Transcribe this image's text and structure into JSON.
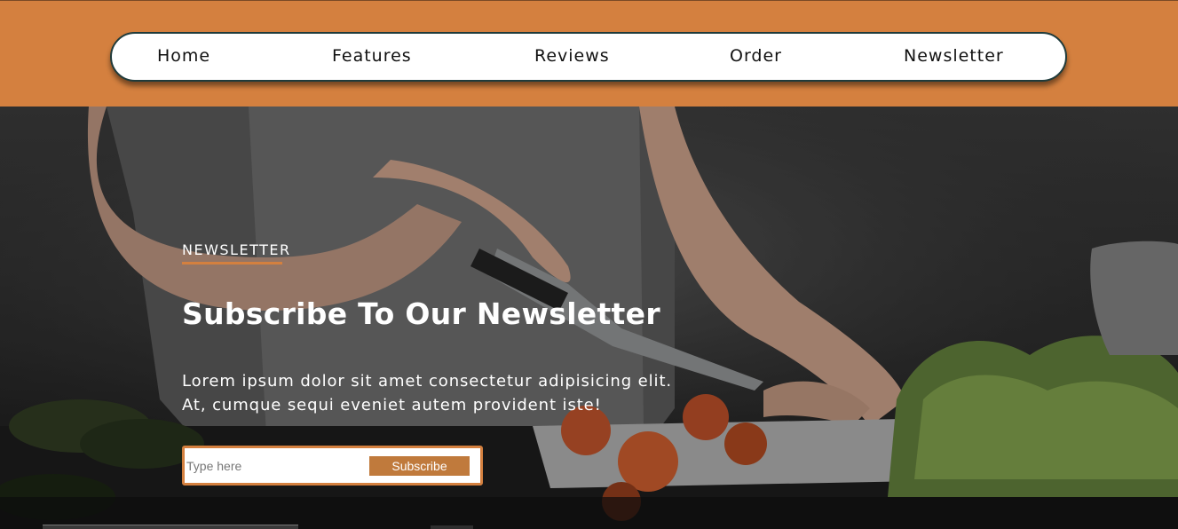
{
  "nav": {
    "items": [
      {
        "label": "Home"
      },
      {
        "label": "Features"
      },
      {
        "label": "Reviews"
      },
      {
        "label": "Order"
      },
      {
        "label": "Newsletter"
      }
    ]
  },
  "newsletter": {
    "eyebrow": "NEWSLETTER",
    "title": "Subscribe To Our Newsletter",
    "text_line1": "Lorem ipsum dolor sit amet consectetur adipisicing elit.",
    "text_line2": "At, cumque sequi eveniet autem provident iste!",
    "input_placeholder": "Type here",
    "input_value": "",
    "button_label": "Subscribe"
  },
  "colors": {
    "accent": "#d4803f",
    "button": "#c07a3c",
    "nav_border": "#1f3b3b"
  }
}
